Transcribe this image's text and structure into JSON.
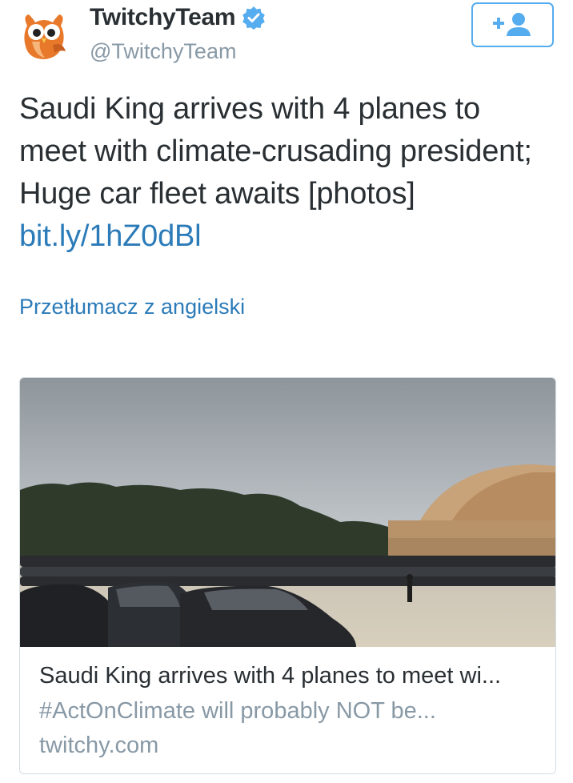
{
  "author": {
    "name": "TwitchyTeam",
    "handle": "@TwitchyTeam",
    "verified": true,
    "avatar_icon": "owl-avatar-icon"
  },
  "follow_button": {
    "icon": "follow-user-plus-icon"
  },
  "tweet": {
    "text": "Saudi King arrives with 4 planes to meet with climate-crusading president; Huge car fleet awaits [photos] ",
    "link": "bit.ly/1hZ0dBl"
  },
  "translate_label": "Przetłumacz z angielski",
  "card": {
    "image_subject": "photo-parking-lot-fleet-of-black-cars-hangar",
    "title": "Saudi King arrives with 4 planes to meet wi...",
    "description": "#ActOnClimate will probably NOT be...",
    "domain": "twitchy.com"
  },
  "colors": {
    "link": "#2b7bb9",
    "accent": "#55acee",
    "text": "#292f33",
    "secondary": "#8899a6",
    "owl": "#e8792b"
  }
}
